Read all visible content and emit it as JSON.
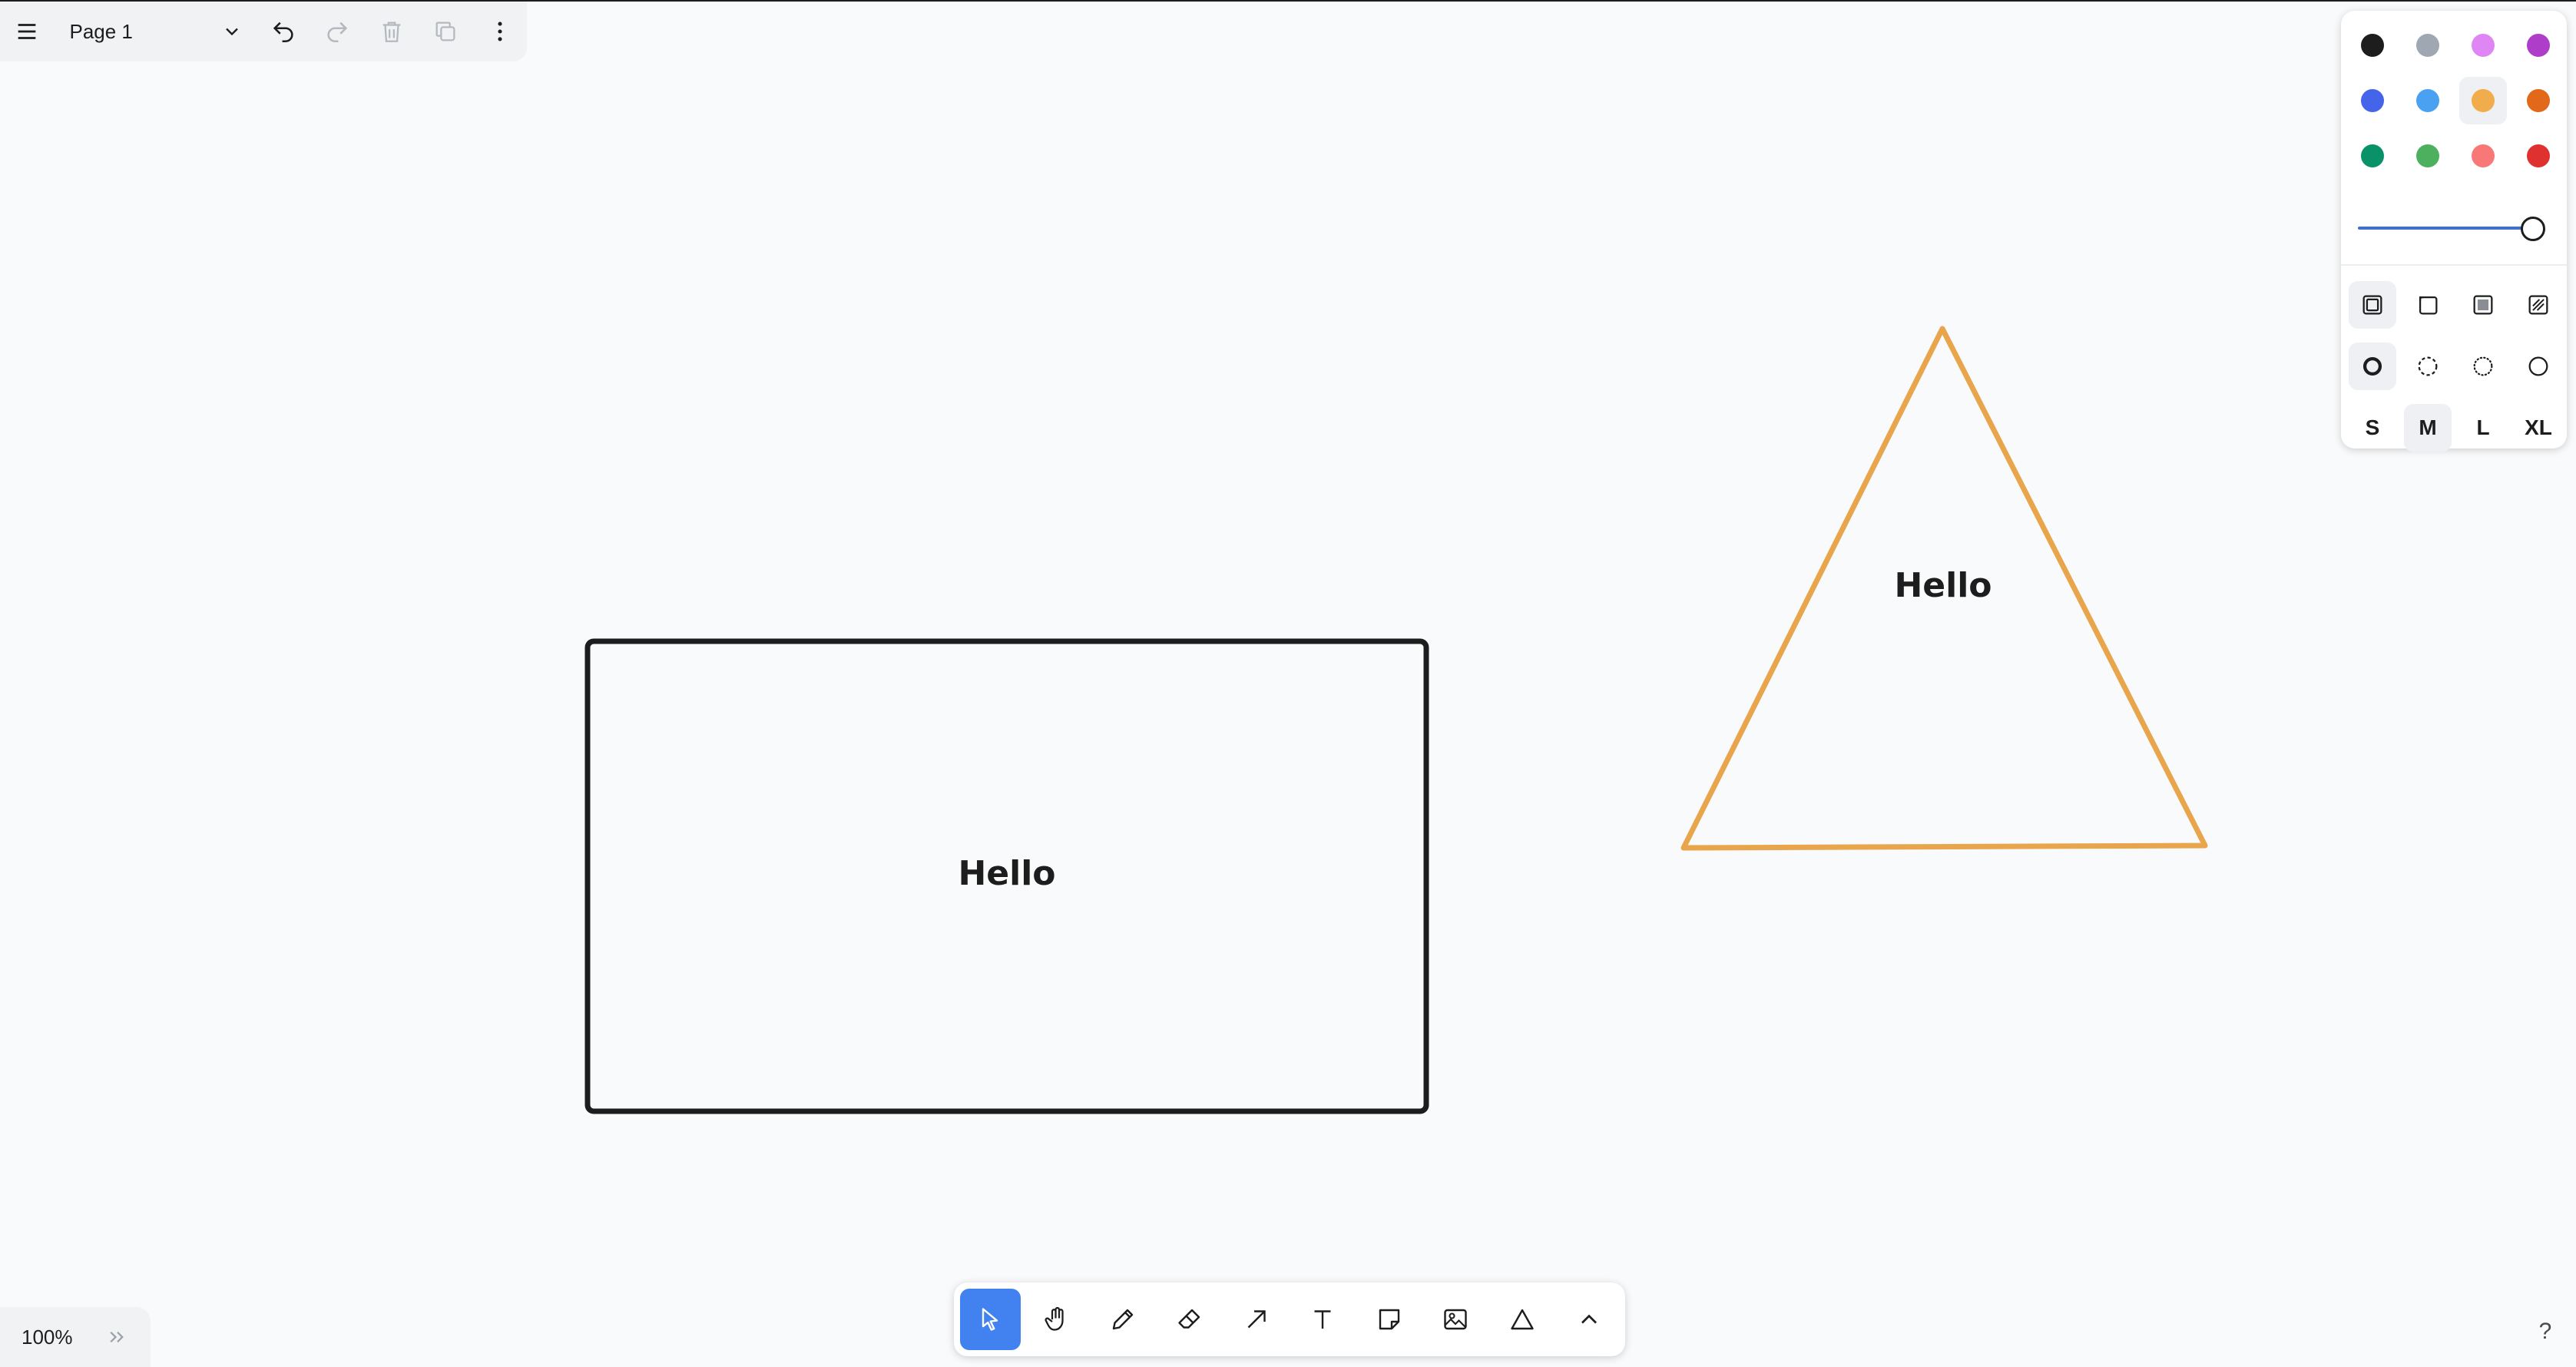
{
  "menu": {
    "page_name": "Page 1"
  },
  "canvas": {
    "rectangle_label": "Hello",
    "triangle_label": "Hello",
    "triangle_color": "#e8a54b",
    "rectangle_color": "#1d1d1d"
  },
  "style_panel": {
    "colors": [
      {
        "name": "black",
        "hex": "#1d1d1d"
      },
      {
        "name": "grey",
        "hex": "#9fa8b2"
      },
      {
        "name": "light-violet",
        "hex": "#e085f4"
      },
      {
        "name": "violet",
        "hex": "#ae3ec9"
      },
      {
        "name": "blue",
        "hex": "#4465e9"
      },
      {
        "name": "light-blue",
        "hex": "#4ba1f1"
      },
      {
        "name": "yellow",
        "hex": "#f1ac4b"
      },
      {
        "name": "orange",
        "hex": "#e16919"
      },
      {
        "name": "green",
        "hex": "#099268"
      },
      {
        "name": "light-green",
        "hex": "#4cb05e"
      },
      {
        "name": "light-red",
        "hex": "#f87777"
      },
      {
        "name": "red",
        "hex": "#e03131"
      }
    ],
    "selected_color": "yellow",
    "opacity": 1.0,
    "fill_options": [
      "fill-none-icon",
      "fill-semi-icon",
      "fill-solid-icon",
      "fill-pattern-icon"
    ],
    "dash_options": [
      "dash-draw-icon",
      "dash-dashed-icon",
      "dash-dotted-icon",
      "dash-solid-icon"
    ],
    "sizes": [
      "S",
      "M",
      "L",
      "XL"
    ],
    "selected_size": "M"
  },
  "zoom": {
    "level": "100%"
  },
  "toolbar": {
    "tools": [
      "select",
      "hand",
      "draw",
      "eraser",
      "arrow",
      "text",
      "note",
      "asset",
      "geo",
      "more"
    ],
    "active_tool": "select"
  },
  "help": {
    "label": "?"
  }
}
